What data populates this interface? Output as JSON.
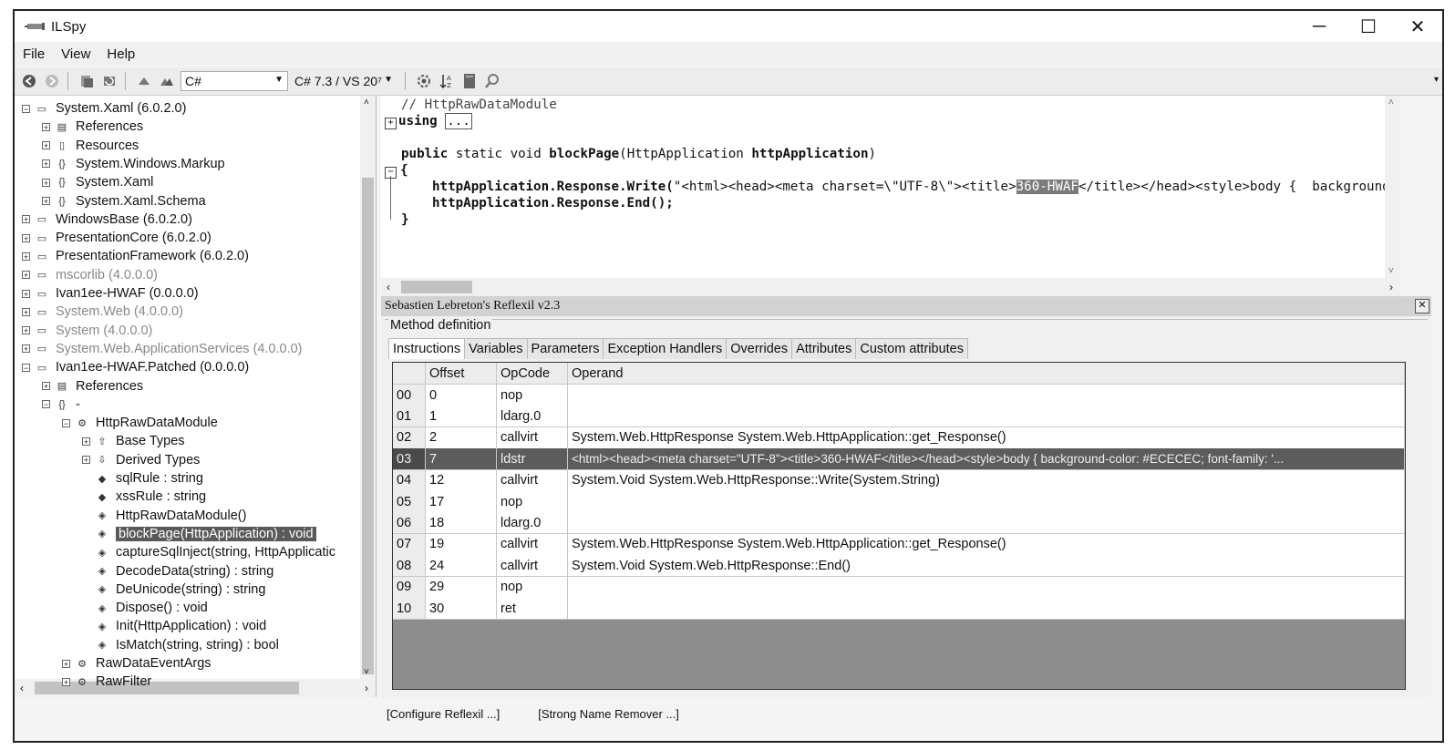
{
  "window": {
    "title": "ILSpy",
    "minimize": "─",
    "maximize": "☐",
    "close": "✕"
  },
  "menu": [
    "File",
    "View",
    "Help"
  ],
  "toolbar": {
    "language": "C#",
    "version": "C# 7.3 / VS 20⁷"
  },
  "tree": [
    {
      "label": "System.Xaml (6.0.2.0)",
      "expander": "⊟",
      "icon": "assembly",
      "gray": false
    },
    {
      "label": "References",
      "expander": "⊞",
      "icon": "references",
      "gray": false
    },
    {
      "label": "Resources",
      "expander": "⊞",
      "icon": "resources",
      "gray": false
    },
    {
      "label": "System.Windows.Markup",
      "expander": "⊞",
      "icon": "namespace",
      "gray": false
    },
    {
      "label": "System.Xaml",
      "expander": "⊞",
      "icon": "namespace",
      "gray": false
    },
    {
      "label": "System.Xaml.Schema",
      "expander": "⊞",
      "icon": "namespace",
      "gray": false
    },
    {
      "label": "WindowsBase (6.0.2.0)",
      "expander": "⊞",
      "icon": "assembly",
      "gray": false
    },
    {
      "label": "PresentationCore (6.0.2.0)",
      "expander": "⊞",
      "icon": "assembly",
      "gray": false
    },
    {
      "label": "PresentationFramework (6.0.2.0)",
      "expander": "⊞",
      "icon": "assembly",
      "gray": false
    },
    {
      "label": "mscorlib (4.0.0.0)",
      "expander": "⊞",
      "icon": "assembly",
      "gray": true
    },
    {
      "label": "Ivan1ee-HWAF (0.0.0.0)",
      "expander": "⊞",
      "icon": "assembly",
      "gray": false
    },
    {
      "label": "System.Web (4.0.0.0)",
      "expander": "⊞",
      "icon": "assembly",
      "gray": true
    },
    {
      "label": "System (4.0.0.0)",
      "expander": "⊞",
      "icon": "assembly",
      "gray": true
    },
    {
      "label": "System.Web.ApplicationServices (4.0.0.0)",
      "expander": "⊞",
      "icon": "assembly",
      "gray": true
    },
    {
      "label": "Ivan1ee-HWAF.Patched (0.0.0.0)",
      "expander": "⊟",
      "icon": "assembly",
      "gray": false
    },
    {
      "label": "References",
      "expander": "⊞",
      "icon": "references",
      "gray": false
    },
    {
      "label": "-",
      "expander": "⊟",
      "icon": "namespace",
      "gray": false
    },
    {
      "label": "HttpRawDataModule",
      "expander": "⊟",
      "icon": "class",
      "gray": false
    },
    {
      "label": "Base Types",
      "expander": "⊞",
      "icon": "basetypes",
      "gray": false
    },
    {
      "label": "Derived Types",
      "expander": "⊞",
      "icon": "derivedtypes",
      "gray": false
    },
    {
      "label": "sqlRule : string",
      "expander": "",
      "icon": "field",
      "gray": false
    },
    {
      "label": "xssRule : string",
      "expander": "",
      "icon": "field",
      "gray": false
    },
    {
      "label": "HttpRawDataModule()",
      "expander": "",
      "icon": "method",
      "gray": false
    },
    {
      "label": "blockPage(HttpApplication) : void",
      "expander": "",
      "icon": "method",
      "gray": false,
      "selected": true
    },
    {
      "label": "captureSqlInject(string, HttpApplicatic",
      "expander": "",
      "icon": "method",
      "gray": false
    },
    {
      "label": "DecodeData(string) : string",
      "expander": "",
      "icon": "method",
      "gray": false
    },
    {
      "label": "DeUnicode(string) : string",
      "expander": "",
      "icon": "method",
      "gray": false
    },
    {
      "label": "Dispose() : void",
      "expander": "",
      "icon": "method",
      "gray": false
    },
    {
      "label": "Init(HttpApplication) : void",
      "expander": "",
      "icon": "method",
      "gray": false
    },
    {
      "label": "IsMatch(string, string) : bool",
      "expander": "",
      "icon": "method",
      "gray": false
    },
    {
      "label": "RawDataEventArgs",
      "expander": "⊞",
      "icon": "class",
      "gray": false
    },
    {
      "label": "RawFilter",
      "expander": "⊞",
      "icon": "class",
      "gray": false
    }
  ],
  "code": {
    "comment": "// HttpRawDataModule",
    "using_kw": "using",
    "using_box": "...",
    "sig_public": "public",
    "sig_rest": " static void ",
    "sig_method": "blockPage",
    "sig_params_open": "(HttpApplication ",
    "sig_param_name": "httpApplication",
    "sig_close": ")",
    "brace_open": "{",
    "line1_a": "httpApplication.Response.Write(",
    "line1_b": "\"<html><head><meta charset=\\\"UTF-8\\\"><title>",
    "line1_hl": "360-HWAF",
    "line1_c": "</title></head><style>body {  background-",
    "line2": "httpApplication.Response.End();",
    "brace_close": "}"
  },
  "reflexil": {
    "title": "Sebastien Lebreton's Reflexil v2.3",
    "group": "Method definition",
    "tabs": [
      "Instructions",
      "Variables",
      "Parameters",
      "Exception Handlers",
      "Overrides",
      "Attributes",
      "Custom attributes"
    ],
    "columns": [
      "Offset",
      "OpCode",
      "Operand"
    ],
    "rows": [
      {
        "idx": "00",
        "offset": "0",
        "opcode": "nop",
        "operand": ""
      },
      {
        "idx": "01",
        "offset": "1",
        "opcode": "ldarg.0",
        "operand": ""
      },
      {
        "idx": "02",
        "offset": "2",
        "opcode": "callvirt",
        "operand": "System.Web.HttpResponse System.Web.HttpApplication::get_Response()"
      },
      {
        "idx": "03",
        "offset": "7",
        "opcode": "ldstr",
        "operand": "<html><head><meta charset=\"UTF-8\"><title>360-HWAF</title></head><style>body {  background-color: #ECECEC;  font-family: '...",
        "selected": true
      },
      {
        "idx": "04",
        "offset": "12",
        "opcode": "callvirt",
        "operand": "System.Void System.Web.HttpResponse::Write(System.String)"
      },
      {
        "idx": "05",
        "offset": "17",
        "opcode": "nop",
        "operand": ""
      },
      {
        "idx": "06",
        "offset": "18",
        "opcode": "ldarg.0",
        "operand": ""
      },
      {
        "idx": "07",
        "offset": "19",
        "opcode": "callvirt",
        "operand": "System.Web.HttpResponse System.Web.HttpApplication::get_Response()"
      },
      {
        "idx": "08",
        "offset": "24",
        "opcode": "callvirt",
        "operand": "System.Void System.Web.HttpResponse::End()"
      },
      {
        "idx": "09",
        "offset": "29",
        "opcode": "nop",
        "operand": ""
      },
      {
        "idx": "10",
        "offset": "30",
        "opcode": "ret",
        "operand": ""
      }
    ],
    "configure_link": "[Configure Reflexil ...]",
    "strong_name_link": "[Strong Name Remover ...]"
  }
}
